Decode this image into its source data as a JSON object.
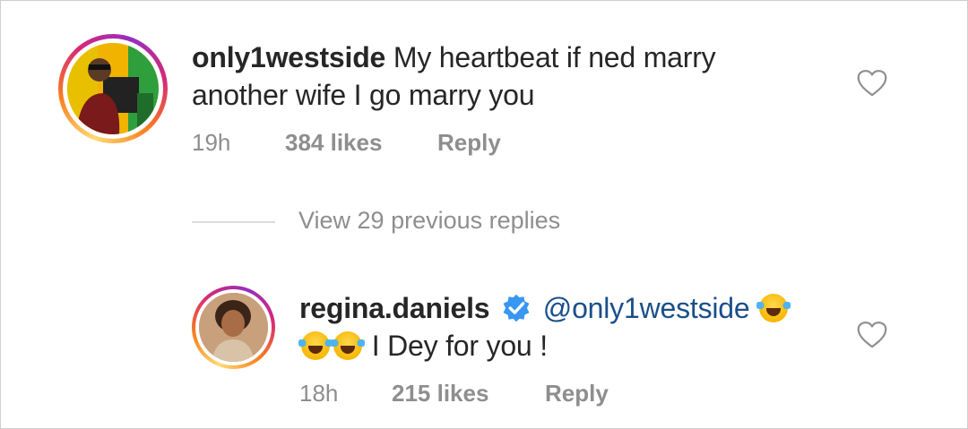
{
  "comments": [
    {
      "username": "only1westside",
      "text_line1": "My heartbeat if ned marry",
      "text_line2": "another wife I go marry you",
      "time": "19h",
      "likes": "384 likes",
      "reply": "Reply"
    }
  ],
  "view_replies": "View 29 previous replies",
  "reply": {
    "username": "regina.daniels",
    "mention": "@only1westside",
    "text": "I Dey for you !",
    "time": "18h",
    "likes": "215 likes",
    "reply": "Reply",
    "emoji_name": "face-with-tears-of-joy-icon"
  },
  "colors": {
    "mention": "#1a4f8a",
    "meta": "#8e8e8e",
    "verified": "#3897f0"
  }
}
